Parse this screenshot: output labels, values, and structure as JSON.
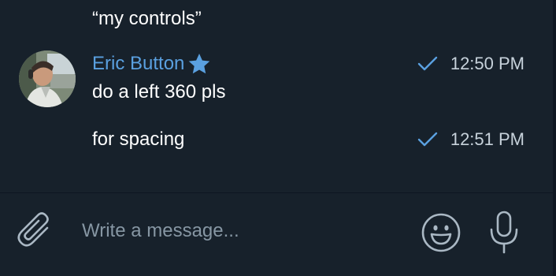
{
  "chat": {
    "previous_message": "“my controls”",
    "messages": [
      {
        "sender": "Eric Button",
        "avatar": "person-in-cockpit-photo",
        "badge_icon": "star-icon",
        "text": "do a left 360 pls",
        "time": "12:50 PM",
        "status_icon": "check-icon"
      },
      {
        "text": "for spacing",
        "time": "12:51 PM",
        "status_icon": "check-icon"
      }
    ]
  },
  "composer": {
    "placeholder": "Write a message...",
    "attach_icon": "paperclip-icon",
    "emoji_icon": "smiley-icon",
    "voice_icon": "microphone-icon"
  },
  "colors": {
    "background": "#17212b",
    "sender_name": "#5aa0e0",
    "check": "#5aa0e0",
    "text": "#ffffff",
    "placeholder": "#8696a3",
    "icon": "#aab8c4"
  }
}
